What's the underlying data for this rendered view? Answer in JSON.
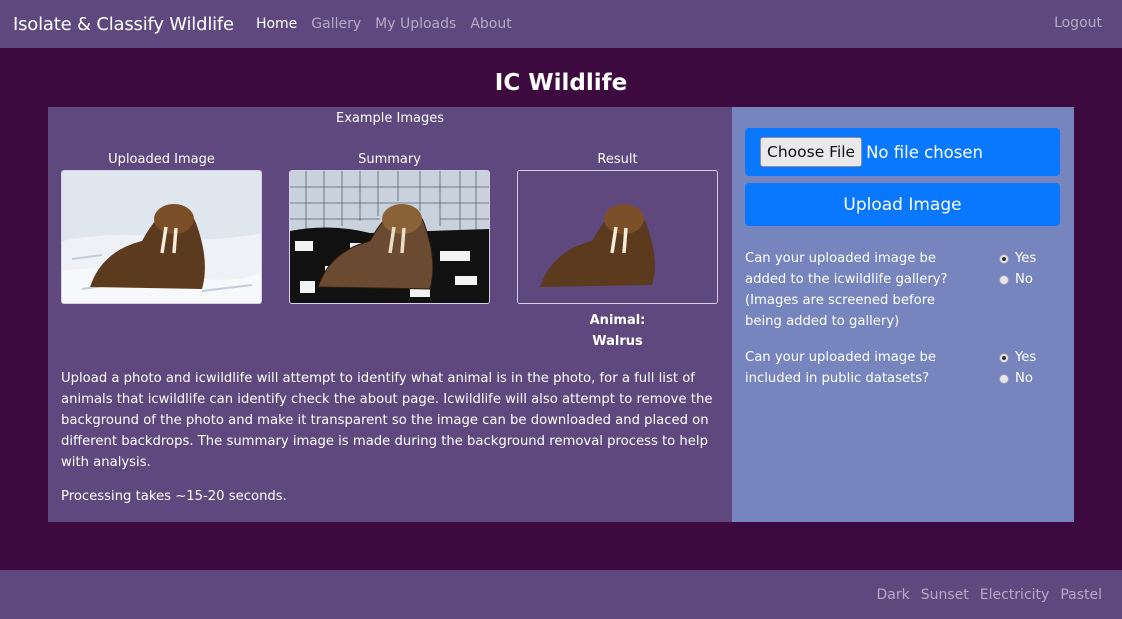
{
  "nav": {
    "brand": "Isolate & Classify Wildlife",
    "links": [
      "Home",
      "Gallery",
      "My Uploads",
      "About"
    ],
    "logout": "Logout"
  },
  "page_title": "IC Wildlife",
  "examples": {
    "title": "Example Images",
    "uploaded_label": "Uploaded Image",
    "summary_label": "Summary",
    "result_label": "Result",
    "animal_label": "Animal:",
    "animal_value": "Walrus"
  },
  "description": "Upload a photo and icwildlife will attempt to identify what animal is in the photo, for a full list of animals that icwildlife can identify check the about page. Icwildlife will also attempt to remove the background of the photo and make it transparent so the image can be downloaded and placed on different backdrops. The summary image is made during the background removal process to help with analysis.",
  "processing_note": "Processing takes ~15-20 seconds.",
  "upload": {
    "choose_file": "Choose File",
    "no_file": "No file chosen",
    "upload_button": "Upload Image"
  },
  "questions": [
    {
      "text": "Can your uploaded image be added to the icwildlife gallery? (Images are screened before being added to gallery)",
      "options": [
        "Yes",
        "No"
      ],
      "selected": "Yes"
    },
    {
      "text": "Can your uploaded image be included in public datasets?",
      "options": [
        "Yes",
        "No"
      ],
      "selected": "Yes"
    }
  ],
  "footer": {
    "themes": [
      "Dark",
      "Sunset",
      "Electricity",
      "Pastel"
    ]
  },
  "colors": {
    "background": "#3d0a3f",
    "navbar": "#5f487e",
    "left_panel": "#5f487e",
    "right_panel": "#7785be",
    "primary_button": "#0a77ff"
  }
}
